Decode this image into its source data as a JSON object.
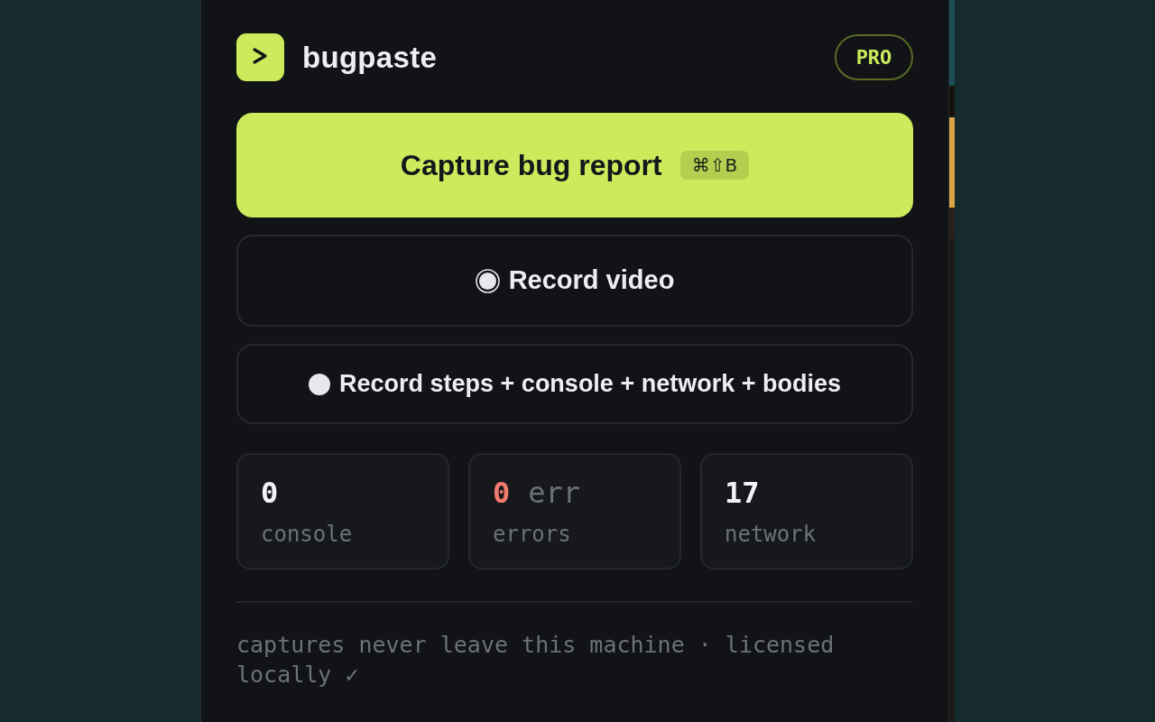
{
  "header": {
    "title": "bugpaste",
    "badge": "PRO"
  },
  "primary_action": {
    "label": "Capture bug report",
    "shortcut": "⌘⇧B"
  },
  "record_actions": [
    {
      "kind": "video",
      "label": "Record video"
    },
    {
      "kind": "steps",
      "label": "Record steps + console + network + bodies"
    }
  ],
  "stats": [
    {
      "kind": "count",
      "value": "0",
      "label": "console"
    },
    {
      "kind": "error",
      "value": "0",
      "unit": "err",
      "label": "errors"
    },
    {
      "kind": "count",
      "value": "17",
      "label": "network"
    }
  ],
  "footer": "captures never leave this machine · licensed locally ✓"
}
